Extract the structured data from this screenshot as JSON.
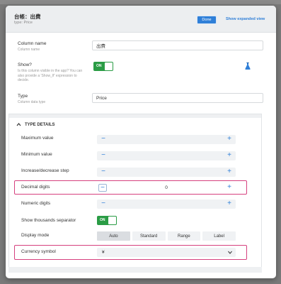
{
  "header": {
    "title": "台帳：出費",
    "subtitle": "type: Price",
    "done_label": "Done",
    "expand_label": "Show expanded view"
  },
  "column_name": {
    "label": "Column name",
    "sub": "Column name",
    "value": "出費"
  },
  "show": {
    "label": "Show?",
    "sub": "Is this column visible in the app? You can also provide a 'Show_If' expression to decide.",
    "toggle_label": "ON"
  },
  "type": {
    "label": "Type",
    "sub": "Column data type",
    "value": "Price"
  },
  "type_details": {
    "title": "TYPE DETAILS",
    "maximum_value": "Maximum value",
    "minimum_value": "Minimum value",
    "step": "Increase/decrease step",
    "decimal_digits": "Decimal digits",
    "decimal_digits_value": "0",
    "numeric_digits": "Numeric digits",
    "thousands_separator": "Show thousands separator",
    "thousands_toggle": "ON",
    "display_mode": "Display mode",
    "display_modes": [
      "Auto",
      "Standard",
      "Range",
      "Label"
    ],
    "display_mode_selected": "Auto",
    "currency_symbol": "Currency symbol",
    "currency_symbol_value": "¥"
  },
  "stepper_minus": "−",
  "stepper_plus": "+",
  "colors": {
    "accent": "#2f7fd8",
    "toggle_on": "#2a9c45",
    "highlight": "#d6407e"
  },
  "icons": [
    "flask-icon",
    "chevron-up-icon",
    "chevron-down-icon"
  ]
}
